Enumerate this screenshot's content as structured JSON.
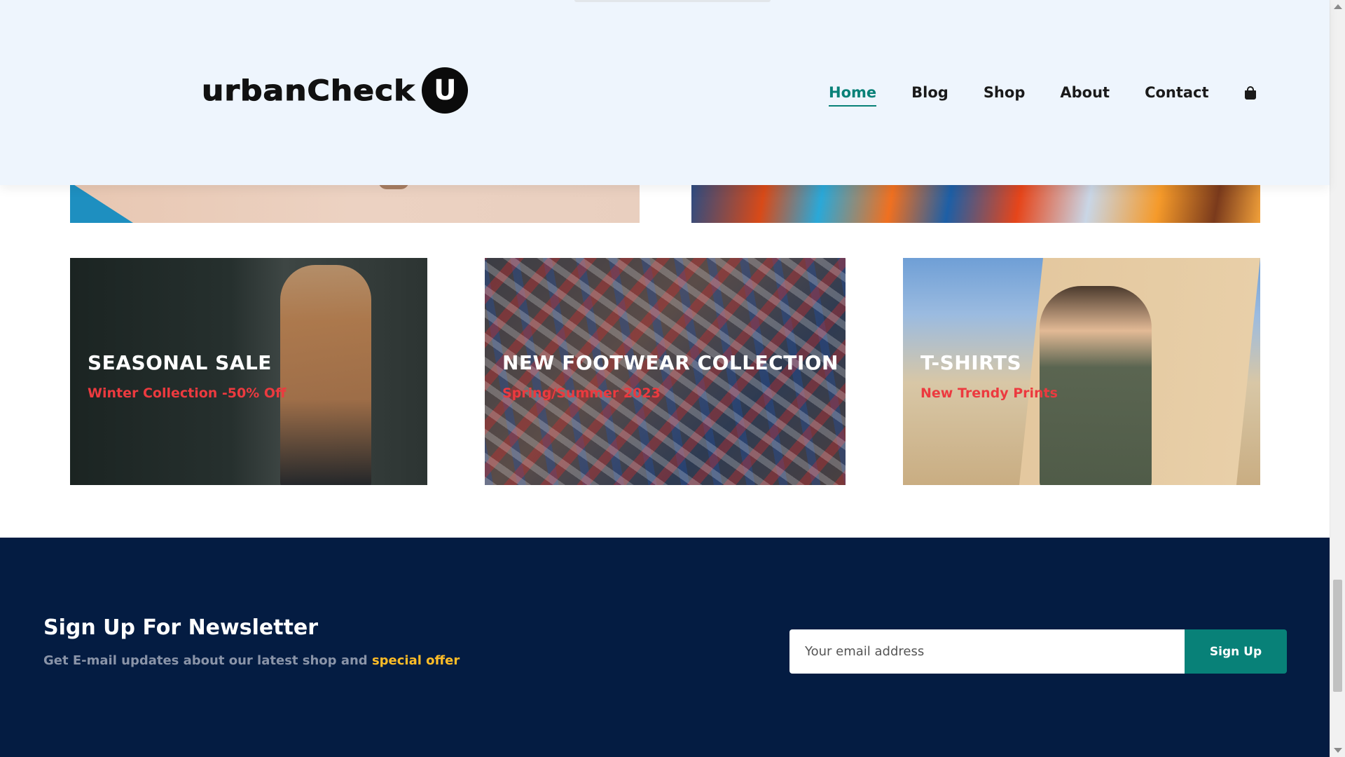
{
  "header": {
    "logo_text": "urbanCheck",
    "logo_badge": "U",
    "nav": [
      {
        "label": "Home",
        "active": true
      },
      {
        "label": "Blog",
        "active": false
      },
      {
        "label": "Shop",
        "active": false
      },
      {
        "label": "About",
        "active": false
      },
      {
        "label": "Contact",
        "active": false
      }
    ],
    "cart_icon": "shopping-bag-icon"
  },
  "categories": [
    {
      "title": "SEASONAL SALE",
      "subtitle": "Winter Collection -50% Off"
    },
    {
      "title": "NEW FOOTWEAR COLLECTION",
      "subtitle": "Spring/Summer 2023"
    },
    {
      "title": "T-SHIRTS",
      "subtitle": "New Trendy Prints"
    }
  ],
  "newsletter": {
    "title": "Sign Up For Newsletter",
    "description": "Get E-mail updates about our latest shop and ",
    "highlight": "special offer",
    "email_placeholder": "Your email address",
    "button_label": "Sign Up"
  },
  "colors": {
    "accent": "#088178",
    "header_bg": "#eef5fd",
    "newsletter_bg": "#041c42",
    "subtitle_red": "#ec3a3f",
    "highlight_yellow": "#ffbd27"
  }
}
